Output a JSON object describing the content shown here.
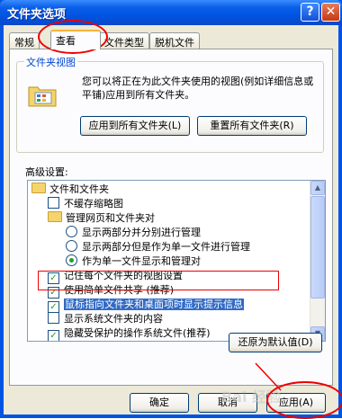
{
  "window": {
    "title": "文件夹选项",
    "help_label": "?",
    "close_label": "✕"
  },
  "tabs": [
    {
      "label": "常规"
    },
    {
      "label": "查看"
    },
    {
      "label": "文件类型"
    },
    {
      "label": "脱机文件"
    }
  ],
  "folder_views": {
    "group_label": "文件夹视图",
    "icon": "folder-views-icon",
    "description": "您可以将正在为此文件夹使用的视图(例如详细信息或平铺)应用到所有文件夹。",
    "apply_all_label": "应用到所有文件夹(L)",
    "reset_all_label": "重置所有文件夹(R)"
  },
  "advanced": {
    "label": "高级设置:",
    "items": [
      {
        "kind": "folder",
        "text": "文件和文件夹"
      },
      {
        "kind": "checkbox",
        "checked": false,
        "text": "不缓存缩略图"
      },
      {
        "kind": "folder",
        "text": "管理网页和文件夹对"
      },
      {
        "kind": "radio",
        "checked": false,
        "text": "显示两部分并分别进行管理"
      },
      {
        "kind": "radio",
        "checked": false,
        "text": "显示两部分但是作为单一文件进行管理"
      },
      {
        "kind": "radio",
        "checked": true,
        "text": "作为单一文件显示和管理对"
      },
      {
        "kind": "checkbox",
        "checked": true,
        "text": "记住每个文件夹的视图设置"
      },
      {
        "kind": "checkbox",
        "checked": true,
        "text": "使用简单文件共享 (推荐)"
      },
      {
        "kind": "checkbox",
        "checked": true,
        "text": "鼠标指向文件夹和桌面项时显示提示信息"
      },
      {
        "kind": "checkbox",
        "checked": false,
        "text": "显示系统文件夹的内容"
      },
      {
        "kind": "checkbox",
        "checked": true,
        "text": "隐藏受保护的操作系统文件(推荐)"
      }
    ],
    "restore_label": "还原为默认值(D)"
  },
  "footer": {
    "ok_label": "确定",
    "cancel_label": "取消",
    "apply_label": "应用(A)"
  },
  "watermark": "Bai 经验"
}
